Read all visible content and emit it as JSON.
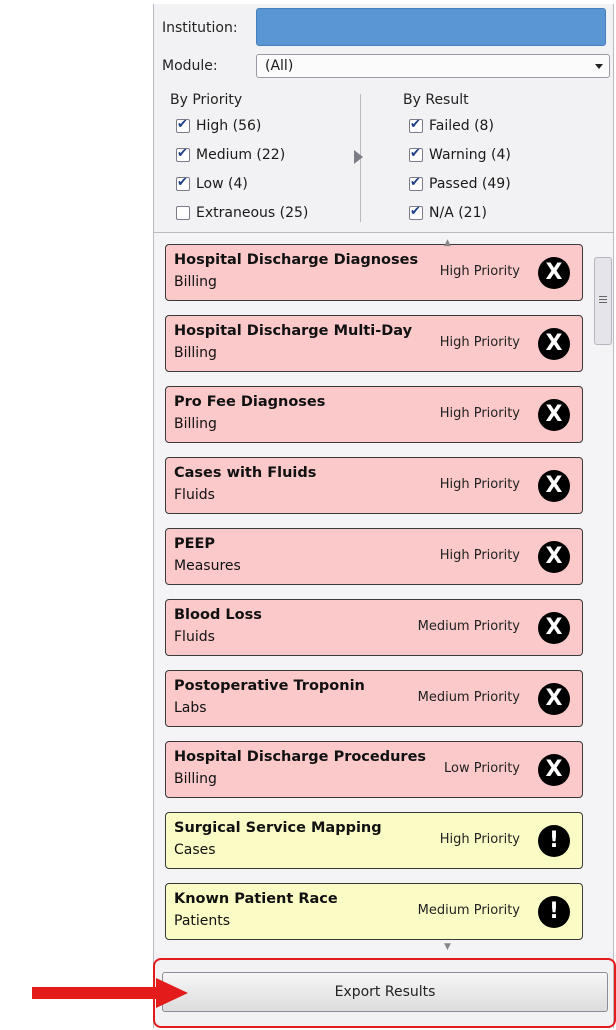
{
  "filters": {
    "institution_label": "Institution:",
    "module_label": "Module:",
    "module_value": "(All)"
  },
  "by_priority": {
    "title": "By Priority",
    "items": [
      {
        "label": "High (56)",
        "checked": true
      },
      {
        "label": "Medium (22)",
        "checked": true
      },
      {
        "label": "Low (4)",
        "checked": true
      },
      {
        "label": "Extraneous (25)",
        "checked": false
      }
    ]
  },
  "by_result": {
    "title": "By Result",
    "items": [
      {
        "label": "Failed (8)",
        "checked": true
      },
      {
        "label": "Warning (4)",
        "checked": true
      },
      {
        "label": "Passed (49)",
        "checked": true
      },
      {
        "label": "N/A (21)",
        "checked": true
      }
    ]
  },
  "results": [
    {
      "title": "Hospital Discharge Diagnoses",
      "subtitle": "Billing",
      "priority": "High Priority",
      "status": "failed",
      "icon": "X"
    },
    {
      "title": "Hospital Discharge Multi-Day",
      "subtitle": "Billing",
      "priority": "High Priority",
      "status": "failed",
      "icon": "X"
    },
    {
      "title": "Pro Fee Diagnoses",
      "subtitle": "Billing",
      "priority": "High Priority",
      "status": "failed",
      "icon": "X"
    },
    {
      "title": "Cases with Fluids",
      "subtitle": "Fluids",
      "priority": "High Priority",
      "status": "failed",
      "icon": "X"
    },
    {
      "title": "PEEP",
      "subtitle": "Measures",
      "priority": "High Priority",
      "status": "failed",
      "icon": "X"
    },
    {
      "title": "Blood Loss",
      "subtitle": "Fluids",
      "priority": "Medium Priority",
      "status": "failed",
      "icon": "X"
    },
    {
      "title": "Postoperative Troponin",
      "subtitle": "Labs",
      "priority": "Medium Priority",
      "status": "failed",
      "icon": "X"
    },
    {
      "title": "Hospital Discharge Procedures",
      "subtitle": "Billing",
      "priority": "Low Priority",
      "status": "failed",
      "icon": "X"
    },
    {
      "title": "Surgical Service Mapping",
      "subtitle": "Cases",
      "priority": "High Priority",
      "status": "warning",
      "icon": "!"
    },
    {
      "title": "Known Patient Race",
      "subtitle": "Patients",
      "priority": "Medium Priority",
      "status": "warning",
      "icon": "!"
    }
  ],
  "export_label": "Export Results",
  "colors": {
    "failed_bg": "#fbc9c9",
    "warning_bg": "#fbfbc6",
    "institution_field": "#5a95d4",
    "highlight": "#e41b1b"
  }
}
